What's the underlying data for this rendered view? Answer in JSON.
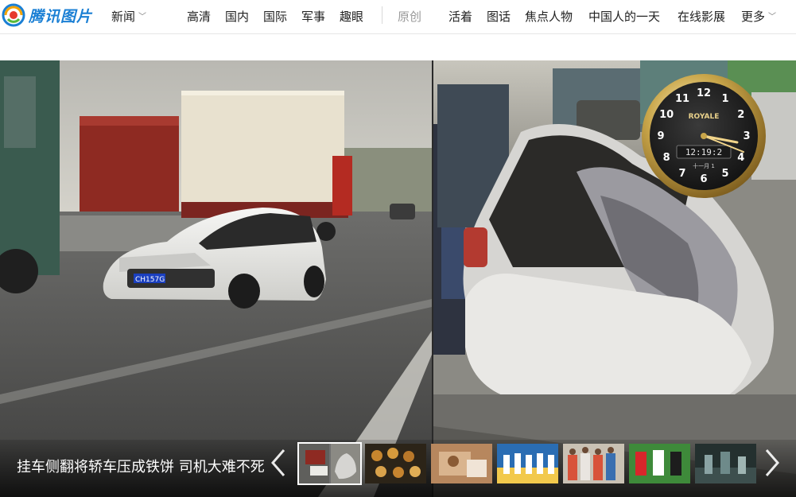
{
  "header": {
    "brand": "腾讯图片",
    "nav": [
      {
        "label": "新闻",
        "has_dropdown": true
      },
      {
        "label": "高清"
      },
      {
        "label": "国内"
      },
      {
        "label": "国际"
      },
      {
        "label": "军事"
      },
      {
        "label": "趣眼"
      },
      {
        "label": "原创",
        "muted": true
      },
      {
        "label": "活着"
      },
      {
        "label": "图话"
      },
      {
        "label": "焦点人物"
      },
      {
        "label": "中国人的一天"
      },
      {
        "label": "在线影展"
      },
      {
        "label": "更多",
        "has_dropdown": true
      }
    ]
  },
  "gallery": {
    "caption": "挂车侧翻将轿车压成铁饼 司机大难不死",
    "prev_icon": "chevron-left-icon",
    "next_icon": "chevron-right-icon",
    "license_plate": "CH157G",
    "thumbnails": [
      {
        "id": "thumb-1",
        "active": true
      },
      {
        "id": "thumb-2"
      },
      {
        "id": "thumb-3"
      },
      {
        "id": "thumb-4"
      },
      {
        "id": "thumb-5"
      },
      {
        "id": "thumb-6"
      },
      {
        "id": "thumb-7"
      }
    ]
  },
  "clock_widget": {
    "brand": "ROYALE",
    "time": "12:19:2",
    "date": "十一月 1",
    "numerals": [
      "12",
      "1",
      "2",
      "3",
      "4",
      "5",
      "6",
      "7",
      "8",
      "9",
      "10",
      "11"
    ]
  },
  "colors": {
    "brand_blue": "#1a7fd4",
    "nav_text": "#222222",
    "nav_muted": "#9a9a9a",
    "clock_gold": "#c9a64a"
  }
}
